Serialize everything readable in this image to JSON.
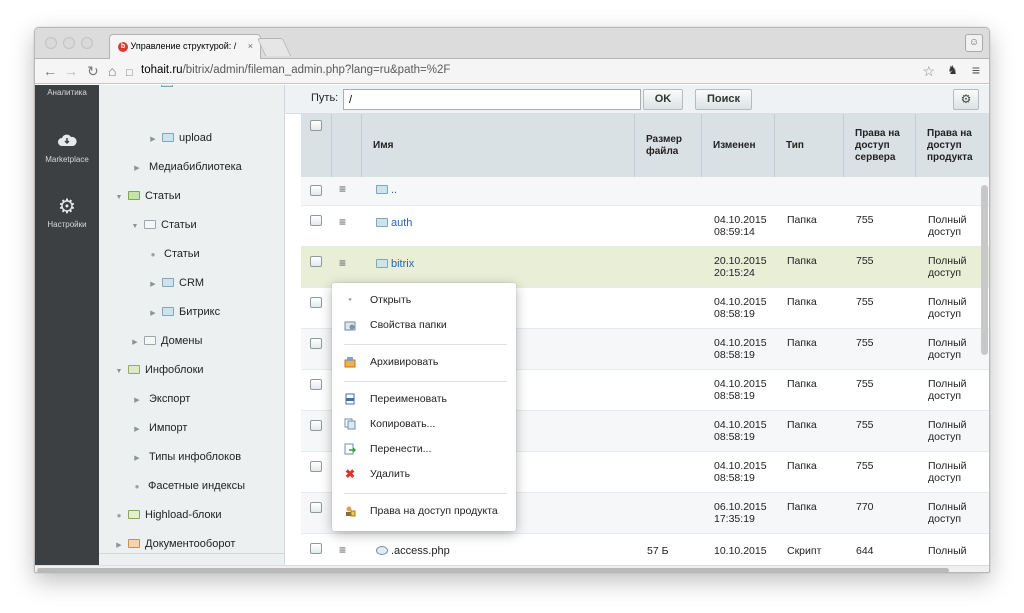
{
  "browser": {
    "tab_title": "Управление структурой: /",
    "tab_close": "×",
    "url_host": "tohait.ru",
    "url_path": "/bitrix/admin/fileman_admin.php?lang=ru&path=%2F"
  },
  "leftbar": {
    "items": [
      {
        "label": "Аналитика"
      },
      {
        "label": "Marketplace"
      },
      {
        "label": "Настройки"
      }
    ]
  },
  "tree": {
    "items": [
      {
        "label": "upload"
      },
      {
        "label": "Медиабиблиотека"
      },
      {
        "label": "Статьи"
      },
      {
        "label": "Статьи"
      },
      {
        "label": "Статьи"
      },
      {
        "label": "CRM"
      },
      {
        "label": "Битрикс"
      },
      {
        "label": "Домены"
      },
      {
        "label": "Инфоблоки"
      },
      {
        "label": "Экспорт"
      },
      {
        "label": "Импорт"
      },
      {
        "label": "Типы инфоблоков"
      },
      {
        "label": "Фасетные индексы"
      },
      {
        "label": "Highload-блоки"
      },
      {
        "label": "Документооборот"
      }
    ]
  },
  "toolbar": {
    "path_label": "Путь:",
    "path_value": "/",
    "ok_label": "OK",
    "search_label": "Поиск"
  },
  "table": {
    "headers": {
      "name": "Имя",
      "size": "Размер файла",
      "modified": "Изменен",
      "type": "Тип",
      "server_rights": "Права на доступ сервера",
      "product_rights": "Права на доступ продукта"
    },
    "rows": [
      {
        "name": "..",
        "date": "",
        "time": "",
        "type": "",
        "rights": "",
        "access1": "",
        "access2": "",
        "size": ""
      },
      {
        "name": "auth",
        "date": "04.10.2015",
        "time": "08:59:14",
        "type": "Папка",
        "rights": "755",
        "access1": "Полный",
        "access2": "доступ",
        "size": ""
      },
      {
        "name": "bitrix",
        "date": "20.10.2015",
        "time": "20:15:24",
        "type": "Папка",
        "rights": "755",
        "access1": "Полный",
        "access2": "доступ",
        "size": ""
      },
      {
        "name": "",
        "date": "04.10.2015",
        "time": "08:58:19",
        "type": "Папка",
        "rights": "755",
        "access1": "Полный",
        "access2": "доступ",
        "size": ""
      },
      {
        "name": "",
        "date": "04.10.2015",
        "time": "08:58:19",
        "type": "Папка",
        "rights": "755",
        "access1": "Полный",
        "access2": "доступ",
        "size": ""
      },
      {
        "name": "",
        "date": "04.10.2015",
        "time": "08:58:19",
        "type": "Папка",
        "rights": "755",
        "access1": "Полный",
        "access2": "доступ",
        "size": ""
      },
      {
        "name": "",
        "date": "04.10.2015",
        "time": "08:58:19",
        "type": "Папка",
        "rights": "755",
        "access1": "Полный",
        "access2": "доступ",
        "size": ""
      },
      {
        "name": "",
        "date": "04.10.2015",
        "time": "08:58:19",
        "type": "Папка",
        "rights": "755",
        "access1": "Полный",
        "access2": "доступ",
        "size": ""
      },
      {
        "name": "",
        "date": "06.10.2015",
        "time": "17:35:19",
        "type": "Папка",
        "rights": "770",
        "access1": "Полный",
        "access2": "доступ",
        "size": ""
      },
      {
        "name": ".access.php",
        "date": "10.10.2015",
        "time": "",
        "type": "Скрипт",
        "rights": "644",
        "access1": "Полный",
        "access2": "",
        "size": "57 Б"
      }
    ]
  },
  "context_menu": {
    "items": [
      {
        "label": "Открыть"
      },
      {
        "label": "Свойства папки"
      },
      {
        "label": "Архивировать"
      },
      {
        "label": "Переименовать"
      },
      {
        "label": "Копировать..."
      },
      {
        "label": "Перенести..."
      },
      {
        "label": "Удалить"
      },
      {
        "label": "Права на доступ продукта"
      }
    ]
  },
  "colors": {
    "sidebar_dark": "#3c4043",
    "tree_bg": "#edf0f1",
    "table_header": "#d9e1e4",
    "selected_row": "#e9eed7",
    "link": "#2067b0",
    "delete_red": "#d9352a"
  },
  "icons": {
    "back": "arrow-left-icon",
    "forward": "arrow-right-icon",
    "reload": "reload-icon",
    "home": "home-icon",
    "page": "page-icon",
    "star": "star-icon",
    "menu": "hamburger-icon",
    "gear": "gear-icon"
  }
}
